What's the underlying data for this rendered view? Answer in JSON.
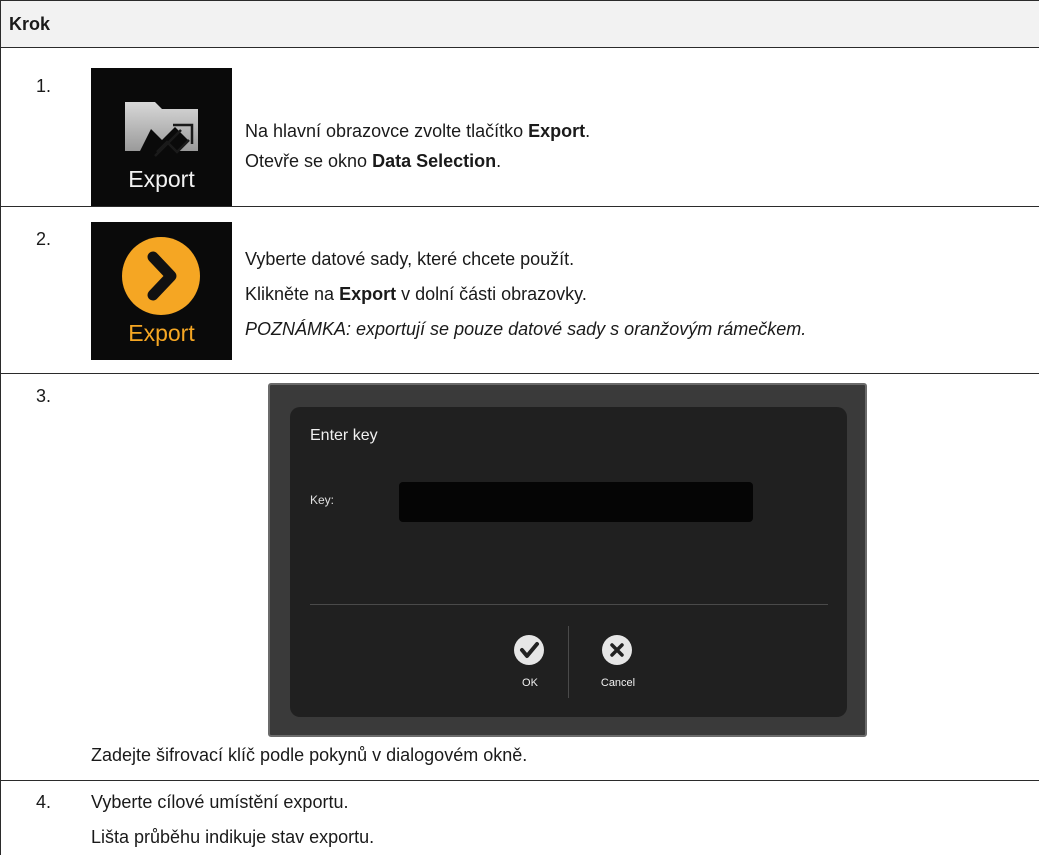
{
  "header": {
    "title": "Krok"
  },
  "steps": [
    {
      "num": "1.",
      "icon_label": "Export",
      "icon": "export-arrow-icon",
      "line1": {
        "pre": "Na hlavní obrazovce zvolte tlačítko ",
        "bold": "Export",
        "post": "."
      },
      "line2": {
        "pre": "Otevře se okno ",
        "bold": "Data Selection",
        "post": "."
      }
    },
    {
      "num": "2.",
      "icon_label": "Export",
      "icon": "chevron-right-circle-icon",
      "line1": "Vyberte datové sady, které chcete použít.",
      "line2": {
        "pre": "Klikněte na ",
        "bold": "Export",
        "post": " v dolní části obrazovky."
      },
      "line3": "POZNÁMKA: exportují se pouze datové sady s oranžovým rámečkem."
    },
    {
      "num": "3.",
      "dialog": {
        "title": "Enter key",
        "key_label": "Key:",
        "key_value": "",
        "ok_label": "OK",
        "cancel_label": "Cancel"
      },
      "caption": "Zadejte šifrovací klíč podle pokynů v dialogovém okně."
    },
    {
      "num": "4.",
      "line1": "Vyberte cílové umístění exportu.",
      "line2": "Lišta průběhu indikuje stav exportu."
    }
  ],
  "colors": {
    "accent": "#f5a623",
    "icon_bg": "#0a0a0a",
    "dialog_bg": "#202020"
  }
}
